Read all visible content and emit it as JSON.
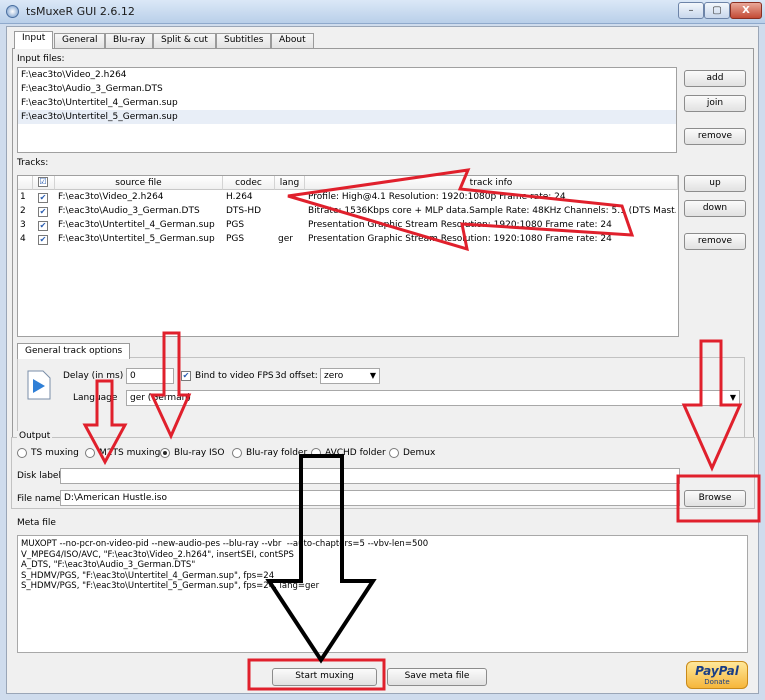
{
  "window": {
    "title": "tsMuxeR GUI 2.6.12",
    "controls": {
      "minimize": "–",
      "maximize": "▢",
      "close": "X"
    }
  },
  "tabs": [
    {
      "label": "Input",
      "active": true
    },
    {
      "label": "General"
    },
    {
      "label": "Blu-ray"
    },
    {
      "label": "Split & cut"
    },
    {
      "label": "Subtitles"
    },
    {
      "label": "About"
    }
  ],
  "input": {
    "label": "Input files:",
    "files": [
      "F:\\eac3to\\Video_2.h264",
      "F:\\eac3to\\Audio_3_German.DTS",
      "F:\\eac3to\\Untertitel_4_German.sup",
      "F:\\eac3to\\Untertitel_5_German.sup"
    ],
    "buttons": {
      "add": "add",
      "join": "join",
      "remove": "remove"
    }
  },
  "tracks": {
    "label": "Tracks:",
    "columns": {
      "check": "☑",
      "source": "source file",
      "codec": "codec",
      "lang": "lang",
      "info": "track info"
    },
    "rows": [
      {
        "num": "1",
        "source": "F:\\eac3to\\Video_2.h264",
        "codec": "H.264",
        "lang": "",
        "info": "Profile: High@4.1  Resolution: 1920:1080p  Frame rate: 24"
      },
      {
        "num": "2",
        "source": "F:\\eac3to\\Audio_3_German.DTS",
        "codec": "DTS-HD",
        "lang": "",
        "info": "Bitrate: 1536Kbps  core + MLP data.Sample Rate: 48KHz  Channels: 5.1 (DTS Mast..."
      },
      {
        "num": "3",
        "source": "F:\\eac3to\\Untertitel_4_German.sup",
        "codec": "PGS",
        "lang": "",
        "info": "Presentation Graphic Stream Resolution: 1920:1080 Frame rate: 24"
      },
      {
        "num": "4",
        "source": "F:\\eac3to\\Untertitel_5_German.sup",
        "codec": "PGS",
        "lang": "ger",
        "info": "Presentation Graphic Stream Resolution: 1920:1080 Frame rate: 24"
      }
    ],
    "buttons": {
      "up": "up",
      "down": "down",
      "remove": "remove"
    }
  },
  "track_options": {
    "title": "General track options",
    "delay_label": "Delay (in ms)",
    "delay_value": "0",
    "bind_fps_label": "Bind to video FPS",
    "offset_label": "3d offset:",
    "offset_value": "zero",
    "language_label": "Language",
    "language_value": "ger (German)"
  },
  "output": {
    "title": "Output",
    "modes": [
      {
        "label": "TS muxing",
        "selected": false
      },
      {
        "label": "M2TS muxing",
        "selected": false
      },
      {
        "label": "Blu-ray ISO",
        "selected": true
      },
      {
        "label": "Blu-ray folder",
        "selected": false
      },
      {
        "label": "AVCHD folder",
        "selected": false
      },
      {
        "label": "Demux",
        "selected": false
      }
    ],
    "disk_label": "Disk label",
    "disk_value": "",
    "file_name_label": "File name",
    "file_name_value": "D:\\American Hustle.iso",
    "browse": "Browse"
  },
  "meta": {
    "title": "Meta file",
    "content": "MUXOPT --no-pcr-on-video-pid --new-audio-pes --blu-ray --vbr  --auto-chapters=5 --vbv-len=500\nV_MPEG4/ISO/AVC, \"F:\\eac3to\\Video_2.h264\", insertSEI, contSPS\nA_DTS, \"F:\\eac3to\\Audio_3_German.DTS\"\nS_HDMV/PGS, \"F:\\eac3to\\Untertitel_4_German.sup\", fps=24\nS_HDMV/PGS, \"F:\\eac3to\\Untertitel_5_German.sup\", fps=24, lang=ger"
  },
  "bottom": {
    "start": "Start muxing",
    "save_meta": "Save meta file",
    "paypal": "PayPal",
    "donate": "Donate"
  },
  "colors": {
    "annotation_red": "#e0202c",
    "annotation_black": "#000000"
  }
}
